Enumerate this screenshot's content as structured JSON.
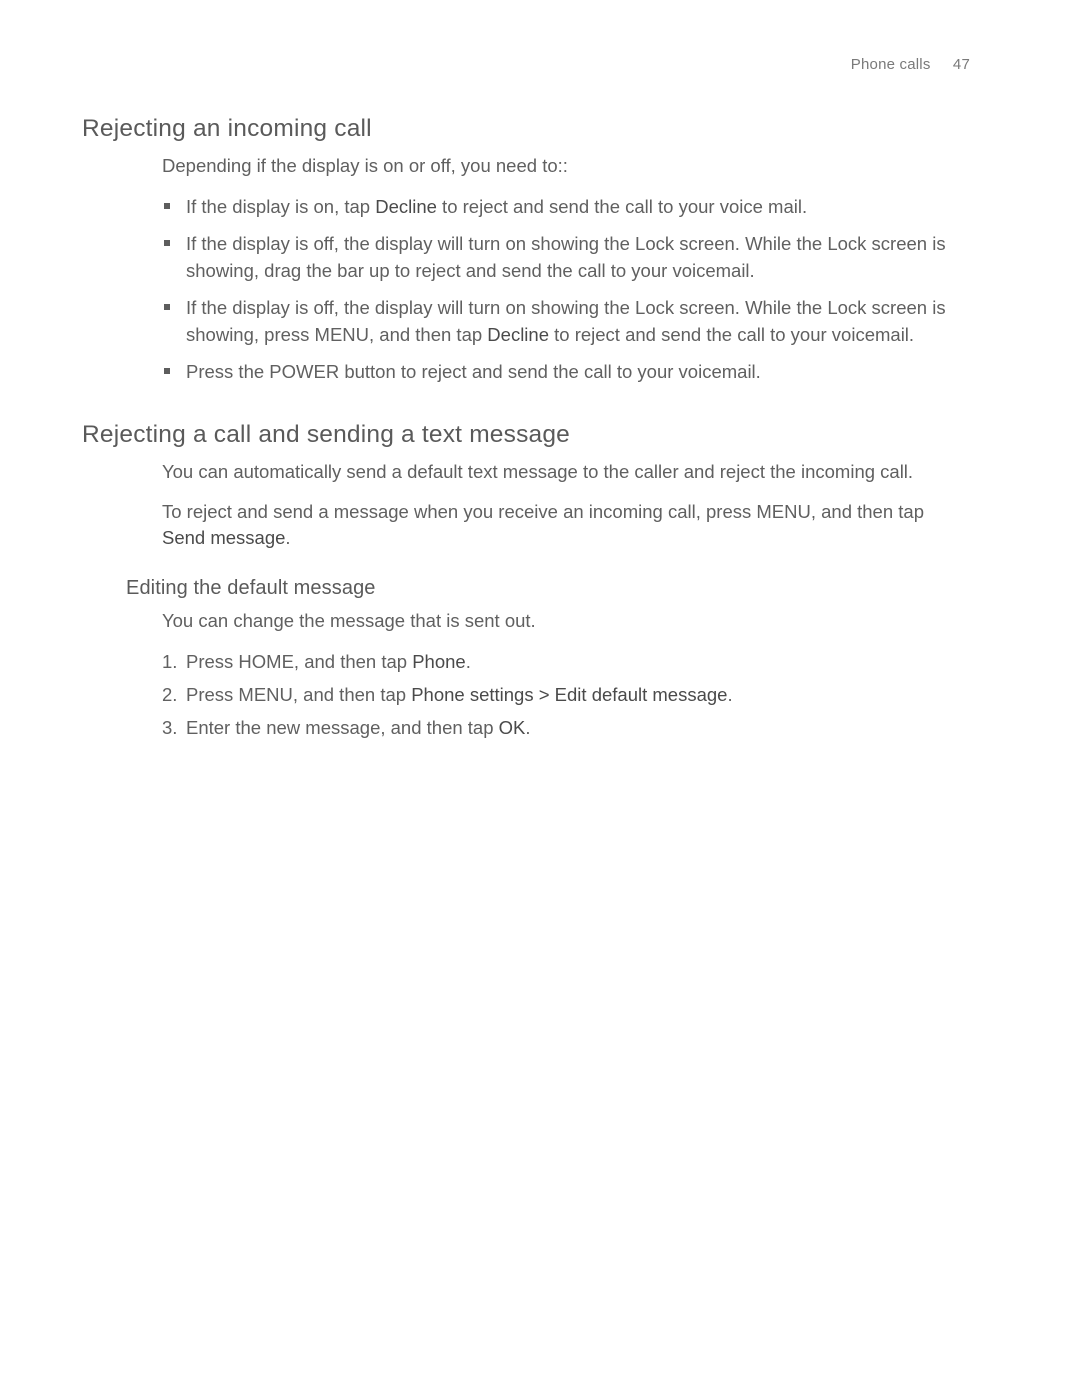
{
  "header": {
    "chapter": "Phone calls",
    "page": "47"
  },
  "section1": {
    "title": "Rejecting an incoming call",
    "intro": "Depending if the display is on or off, you need to::",
    "bullets": {
      "b1_a": "If the display is on, tap ",
      "b1_b": "Decline",
      "b1_c": " to reject and send the call to your voice mail.",
      "b2": "If the display is off, the display will turn on showing the Lock screen. While the Lock screen is showing, drag the bar up to reject and send the call to your voicemail.",
      "b3_a": "If the display is off, the display will turn on showing the Lock screen. While the Lock screen is showing, press MENU, and then tap ",
      "b3_b": "Decline",
      "b3_c": " to reject and send the call to your voicemail.",
      "b4": "Press the POWER button to reject and send the call to your voicemail."
    }
  },
  "section2": {
    "title": "Rejecting a call and sending a text message",
    "p1": "You can automatically send a default text message to the caller and reject the incoming call.",
    "p2_a": "To reject and send a message when you receive an incoming call, press MENU, and then tap ",
    "p2_b": "Send message",
    "p2_c": "."
  },
  "section3": {
    "title": "Editing the default message",
    "p": "You can change the message that is sent out.",
    "steps": {
      "s1_a": "Press HOME, and then tap ",
      "s1_b": "Phone",
      "s1_c": ".",
      "s2_a": "Press MENU, and then tap ",
      "s2_b": "Phone settings > Edit default message",
      "s2_c": ".",
      "s3_a": "Enter the new message, and then tap ",
      "s3_b": "OK",
      "s3_c": "."
    }
  }
}
